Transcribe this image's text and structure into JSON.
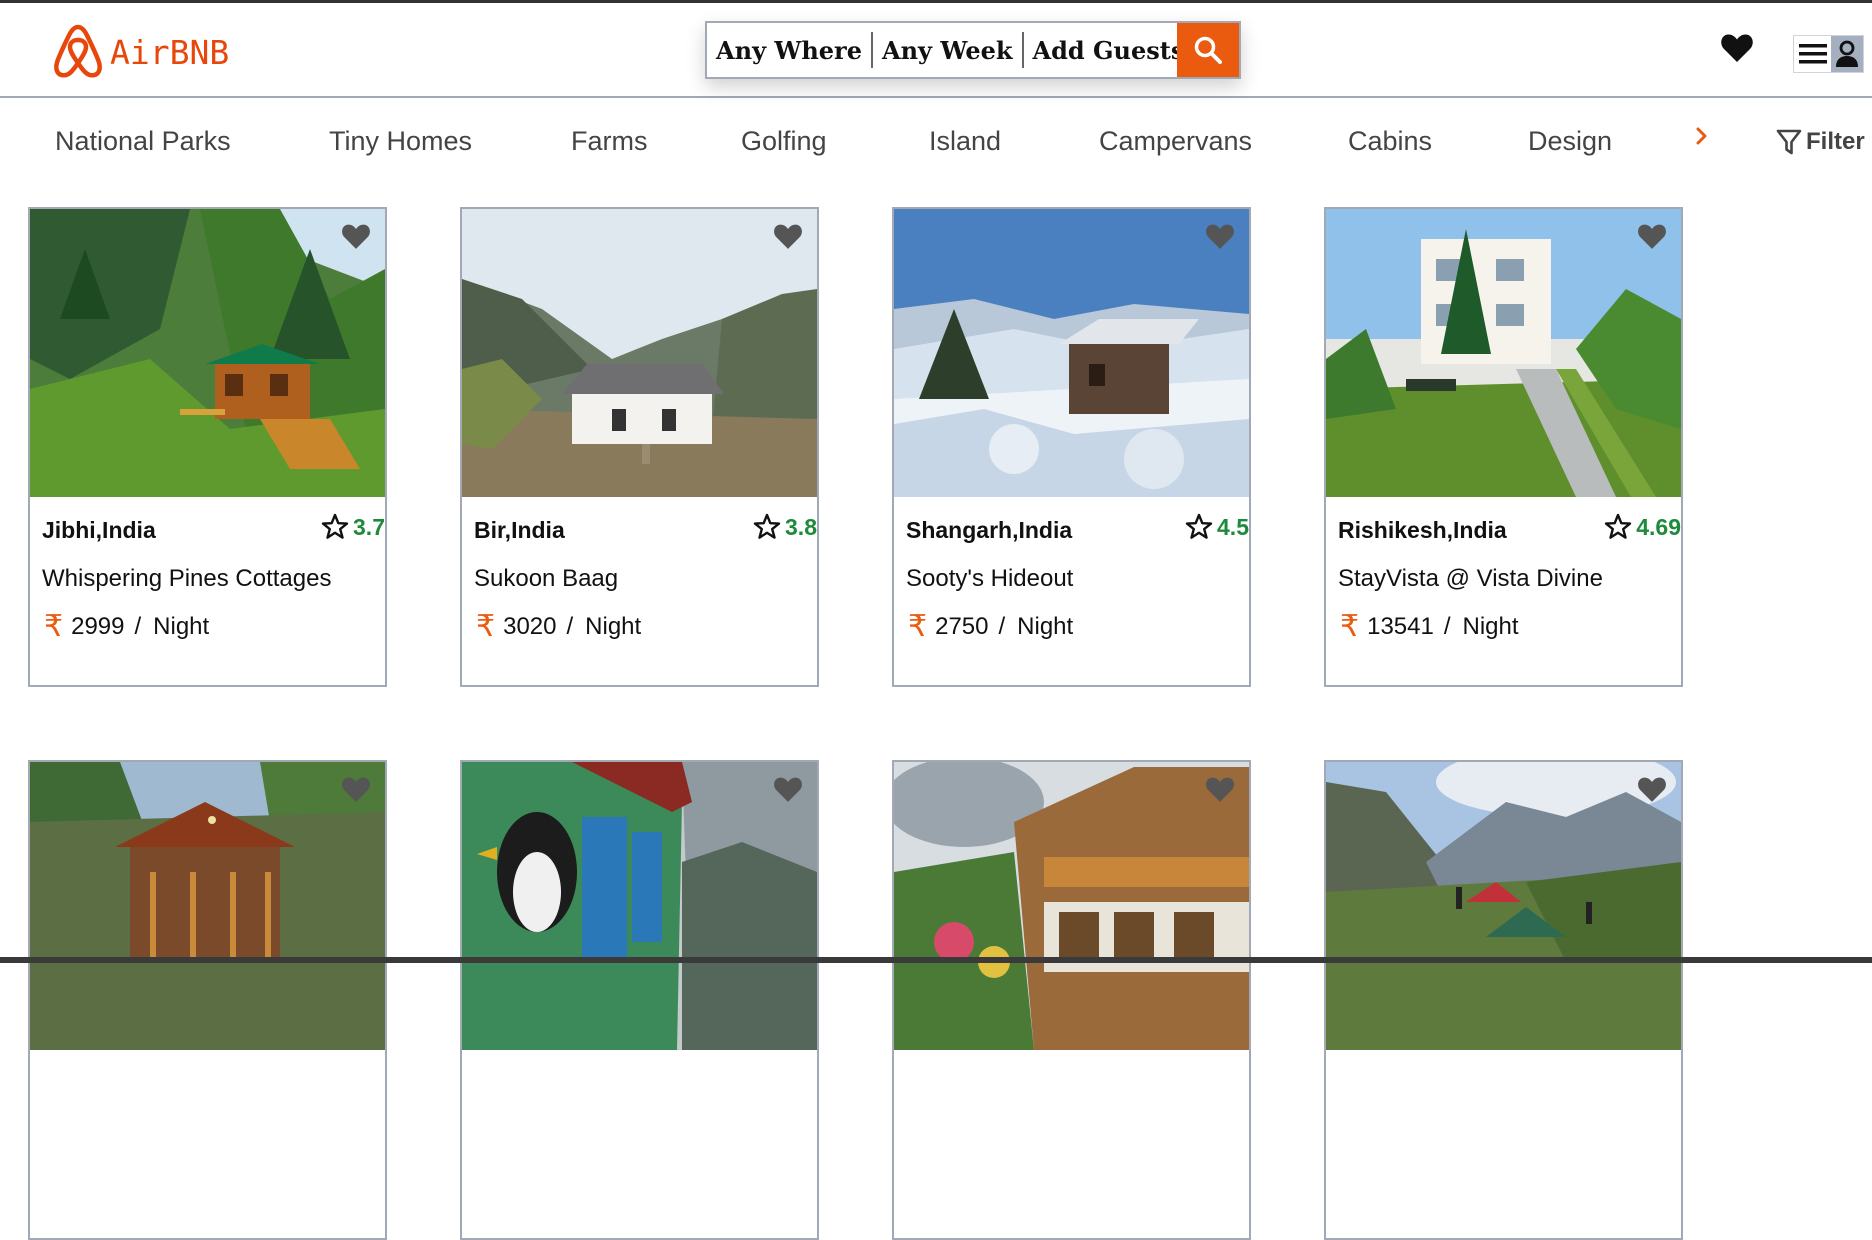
{
  "brand": {
    "name": "AirBNB",
    "accent": "#eb5b0f"
  },
  "search": {
    "where": "Any Where",
    "week": "Any Week",
    "guests": "Add Guests"
  },
  "icons": {
    "logo": "airbnb-logo",
    "search": "search-icon",
    "wishlist": "heart-icon",
    "menu": "hamburger-menu-icon",
    "user": "user-icon",
    "next": "chevron-right-icon",
    "filter": "filter-icon",
    "rating": "star-outline-icon",
    "currency": "rupee-icon"
  },
  "categories": [
    "National Parks",
    "Tiny Homes",
    "Farms",
    "Golfing",
    "Island",
    "Campervans",
    "Cabins",
    "Design"
  ],
  "filter_label": "Filter",
  "currency_symbol": "₹",
  "price_unit": "Night",
  "price_sep": "/",
  "listings": [
    {
      "location": "Jibhi,India",
      "rating": "3.7",
      "title": "Whispering Pines Cottages",
      "price": "2999"
    },
    {
      "location": "Bir,India",
      "rating": "3.8",
      "title": "Sukoon Baag",
      "price": "3020"
    },
    {
      "location": "Shangarh,India",
      "rating": "4.5",
      "title": "Sooty's Hideout",
      "price": "2750"
    },
    {
      "location": "Rishikesh,India",
      "rating": "4.69",
      "title": "StayVista @ Vista Divine",
      "price": "13541"
    }
  ]
}
